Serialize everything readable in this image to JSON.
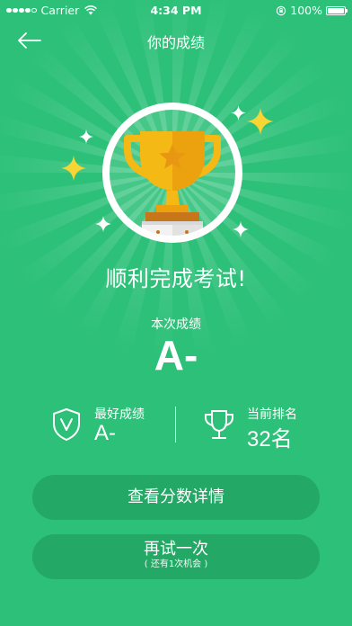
{
  "status_bar": {
    "carrier": "Carrier",
    "time": "4:34 PM",
    "battery": "100%",
    "signal_bars": 4
  },
  "nav": {
    "title": "你的成绩",
    "back_icon": "back-arrow-icon"
  },
  "result": {
    "headline": "顺利完成考试!",
    "score_label": "本次成绩",
    "score_value": "A-"
  },
  "stats": {
    "best": {
      "label": "最好成绩",
      "value": "A-",
      "icon": "shield-v-icon"
    },
    "rank": {
      "label": "当前排名",
      "value": "32名",
      "icon": "trophy-outline-icon"
    }
  },
  "buttons": {
    "details": "查看分数详情",
    "retry": "再试一次",
    "retry_sub": "( 还有1次机会 )"
  },
  "colors": {
    "background": "#2cc078",
    "button": "#23a866",
    "trophy_gold": "#f5b915",
    "sparkle_gold": "#f7d535"
  }
}
